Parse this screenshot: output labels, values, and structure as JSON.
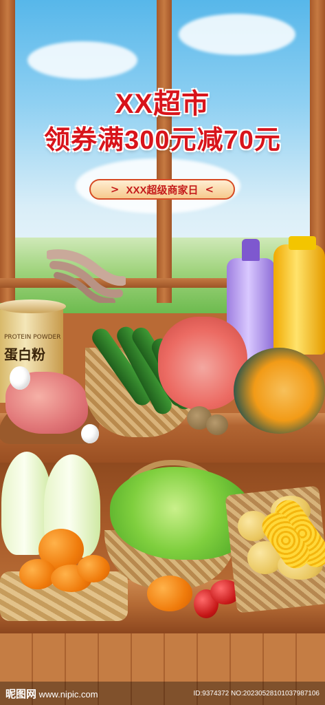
{
  "poster": {
    "headline": "XX超市",
    "subheadline": "领券满300元减70元",
    "tag": {
      "text": "XXX超级商家日",
      "left_arrows": ">",
      "right_arrows": "<"
    }
  },
  "products": {
    "protein_can": {
      "label_small": "PROTEIN POWDER",
      "label_big": "蛋白粉"
    }
  },
  "watermark": {
    "site": "昵图网",
    "url": "www.nipic.com",
    "id": "ID:9374372 NO:20230528101037987106"
  },
  "colors": {
    "headline": "#d8141b",
    "tag_border": "#d64a24",
    "tag_bg": "#f6c98c",
    "wood": "#b56a34"
  },
  "icons": {
    "tag_left": "chevron-right-icon",
    "tag_right": "chevron-left-icon"
  }
}
